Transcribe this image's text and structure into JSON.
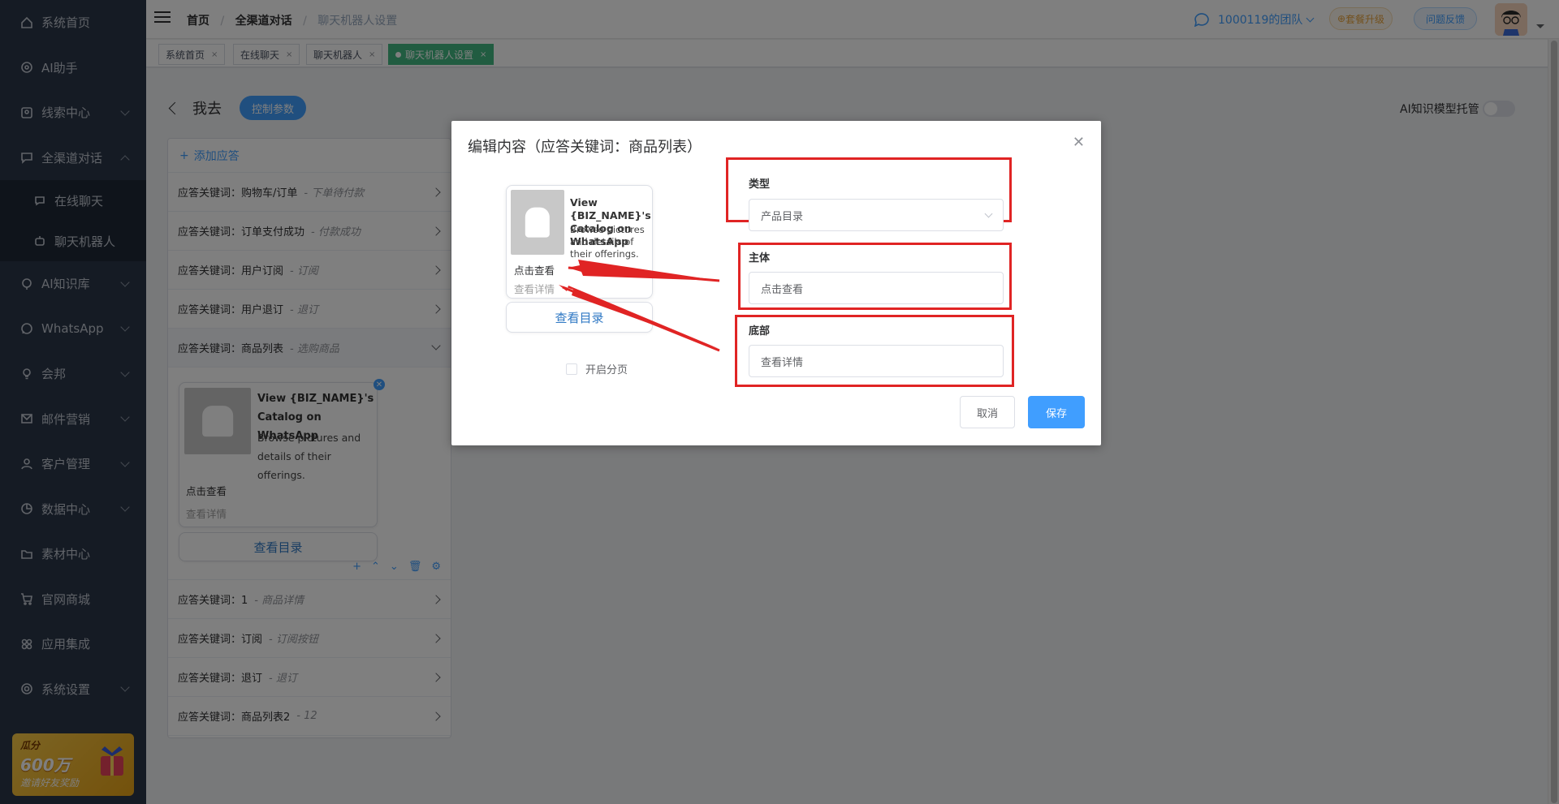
{
  "sidebar": {
    "items": [
      {
        "label": "系统首页",
        "icon": "home-icon"
      },
      {
        "label": "AI助手",
        "icon": "ai-icon"
      },
      {
        "label": "线索中心",
        "icon": "leads-icon"
      },
      {
        "label": "全渠道对话",
        "icon": "chat-icon"
      },
      {
        "label": "在线聊天",
        "icon": "online-chat-icon"
      },
      {
        "label": "聊天机器人",
        "icon": "robot-icon"
      },
      {
        "label": "AI知识库",
        "icon": "knowledge-icon"
      },
      {
        "label": "WhatsApp",
        "icon": "whatsapp-icon"
      },
      {
        "label": "会邦",
        "icon": "bulb-icon"
      },
      {
        "label": "邮件营销",
        "icon": "mail-icon"
      },
      {
        "label": "客户管理",
        "icon": "customer-icon"
      },
      {
        "label": "数据中心",
        "icon": "data-icon"
      },
      {
        "label": "素材中心",
        "icon": "folder-icon"
      },
      {
        "label": "官网商城",
        "icon": "cart-icon"
      },
      {
        "label": "应用集成",
        "icon": "apps-icon"
      },
      {
        "label": "系统设置",
        "icon": "settings-icon"
      }
    ],
    "promo": {
      "line1": "瓜分",
      "line2": "600万",
      "line3": "邀请好友奖励"
    }
  },
  "header": {
    "breadcrumb": [
      "首页",
      "全渠道对话",
      "聊天机器人设置"
    ],
    "team": "1000119的团队",
    "upgrade": "套餐升级",
    "feedback": "问题反馈"
  },
  "tags": [
    {
      "label": "系统首页"
    },
    {
      "label": "在线聊天"
    },
    {
      "label": "聊天机器人"
    },
    {
      "label": "聊天机器人设置"
    }
  ],
  "page": {
    "title": "我去",
    "control_params": "控制参数",
    "ai_toggle_label": "AI知识模型托管",
    "add_reply": "添加应答",
    "keywords": [
      {
        "label": "应答关键词：购物车/订单",
        "sub": "- 下单待付款"
      },
      {
        "label": "应答关键词：订单支付成功",
        "sub": "- 付款成功"
      },
      {
        "label": "应答关键词：用户订阅",
        "sub": "- 订阅"
      },
      {
        "label": "应答关键词：用户退订",
        "sub": "- 退订"
      },
      {
        "label": "应答关键词：商品列表",
        "sub": "- 选购商品"
      },
      {
        "label": "应答关键词：1",
        "sub": "- 商品详情"
      },
      {
        "label": "应答关键词：订阅",
        "sub": "- 订阅按钮"
      },
      {
        "label": "应答关键词：退订",
        "sub": "- 退订"
      },
      {
        "label": "应答关键词：商品列表2",
        "sub": "- 12"
      }
    ],
    "preview_card": {
      "title": "View {BIZ_NAME}'s Catalog on WhatsApp",
      "desc": "Browse pictures and details of their offerings.",
      "body": "点击查看",
      "footer": "查看详情",
      "button": "查看目录"
    }
  },
  "dialog": {
    "title": "编辑内容（应答关键词：商品列表）",
    "card": {
      "title": "View {BIZ_NAME}'s Catalog on WhatsApp",
      "desc": "Browse pictures and details of their offerings.",
      "body": "点击查看",
      "footer": "查看详情",
      "button": "查看目录"
    },
    "paging_label": "开启分页",
    "type_label": "类型",
    "type_value": "产品目录",
    "body_label": "主体",
    "body_value": "点击查看",
    "footer_label": "底部",
    "footer_value": "查看详情",
    "cancel": "取消",
    "save": "保存"
  },
  "colors": {
    "sidebar_bg": "#2b3648",
    "primary": "#409eff",
    "active_tag": "#42b983",
    "annotation_red": "#e02424"
  }
}
